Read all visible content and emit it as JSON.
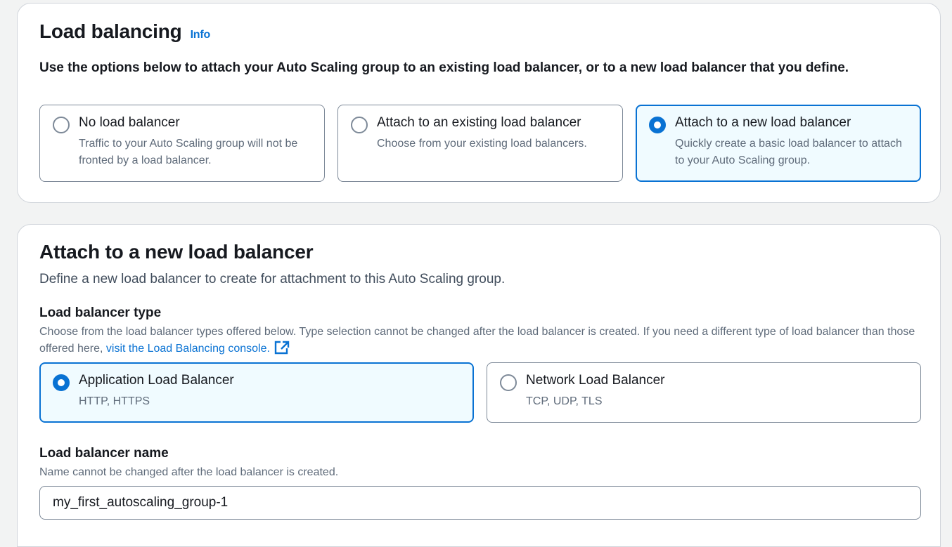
{
  "load_balancing": {
    "title": "Load balancing",
    "info_label": "Info",
    "description": "Use the options below to attach your Auto Scaling group to an existing load balancer, or to a new load balancer that you define.",
    "options": [
      {
        "title": "No load balancer",
        "description": "Traffic to your Auto Scaling group will not be fronted by a load balancer.",
        "selected": false
      },
      {
        "title": "Attach to an existing load balancer",
        "description": "Choose from your existing load balancers.",
        "selected": false
      },
      {
        "title": "Attach to a new load balancer",
        "description": "Quickly create a basic load balancer to attach to your Auto Scaling group.",
        "selected": true
      }
    ]
  },
  "new_load_balancer": {
    "title": "Attach to a new load balancer",
    "description": "Define a new load balancer to create for attachment to this Auto Scaling group.",
    "type_label": "Load balancer type",
    "type_hint": "Choose from the load balancer types offered below. Type selection cannot be changed after the load balancer is created. If you need a different type of load balancer than those offered here,",
    "type_hint_link": "visit the Load Balancing console.",
    "types": [
      {
        "title": "Application Load Balancer",
        "description": "HTTP, HTTPS",
        "selected": true
      },
      {
        "title": "Network Load Balancer",
        "description": "TCP, UDP, TLS",
        "selected": false
      }
    ],
    "name_label": "Load balancer name",
    "name_hint": "Name cannot be changed after the load balancer is created.",
    "name_value": "my_first_autoscaling_group-1"
  },
  "colors": {
    "accent": "#0972d3",
    "selected_bg": "#f0fbff",
    "border": "#7d8998",
    "page_bg": "#f2f3f3"
  },
  "icons": {
    "external_link": "external-link-icon"
  }
}
